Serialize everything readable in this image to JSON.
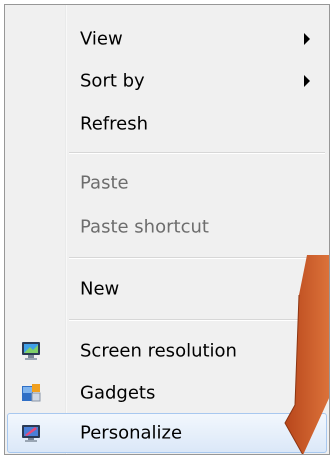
{
  "menu": {
    "items": [
      {
        "label": "View",
        "submenu": true
      },
      {
        "label": "Sort by",
        "submenu": true
      },
      {
        "label": "Refresh"
      },
      {
        "label": "Paste",
        "disabled": true
      },
      {
        "label": "Paste shortcut",
        "disabled": true
      },
      {
        "label": "New"
      },
      {
        "label": "Screen resolution",
        "icon": "monitor-icon"
      },
      {
        "label": "Gadgets",
        "icon": "gadgets-icon"
      },
      {
        "label": "Personalize",
        "icon": "personalize-icon",
        "highlighted": true
      }
    ]
  },
  "colors": {
    "menu_background": "#f0f0f0",
    "disabled_text": "#6d6d6d",
    "highlight_border": "#a8c8ef",
    "annotation_arrow": "#d2602a"
  }
}
